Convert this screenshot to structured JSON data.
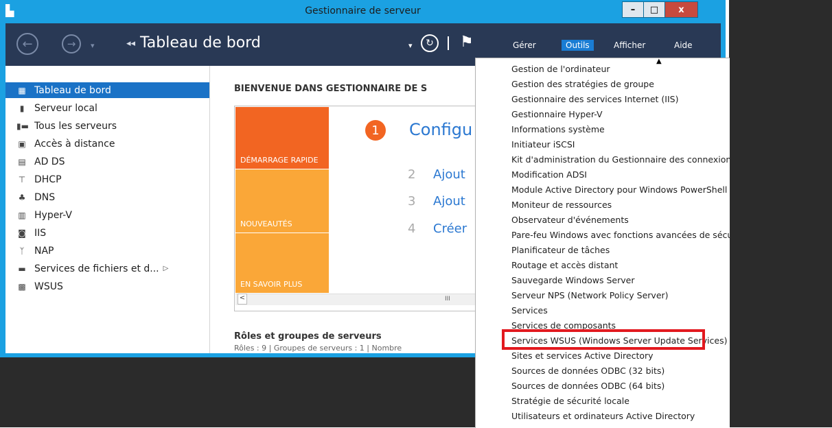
{
  "window": {
    "title": "Gestionnaire de serveur",
    "buttons": {
      "minimize": "–",
      "maximize": "□",
      "close": "x"
    }
  },
  "toolbar": {
    "back": "←",
    "forward": "→",
    "nav_dropdown": "▾",
    "crumb_arrows": "◂◂",
    "page_title": "Tableau de bord",
    "dropdown_arrow": "▾",
    "refresh": "↻",
    "flag": "⚑",
    "menus": [
      "Gérer",
      "Outils",
      "Afficher",
      "Aide"
    ]
  },
  "sidebar": {
    "items": [
      {
        "label": "Tableau de bord",
        "icon": "▦"
      },
      {
        "label": "Serveur local",
        "icon": "▮"
      },
      {
        "label": "Tous les serveurs",
        "icon": "▮▬"
      },
      {
        "label": "Accès à distance",
        "icon": "▣"
      },
      {
        "label": "AD DS",
        "icon": "▤"
      },
      {
        "label": "DHCP",
        "icon": "⊤"
      },
      {
        "label": "DNS",
        "icon": "♣"
      },
      {
        "label": "Hyper-V",
        "icon": "▥"
      },
      {
        "label": "IIS",
        "icon": "◙"
      },
      {
        "label": "NAP",
        "icon": "ᛉ"
      },
      {
        "label": "Services de fichiers et d...",
        "icon": "▬",
        "arrow": "▷"
      },
      {
        "label": "WSUS",
        "icon": "▩"
      }
    ]
  },
  "main": {
    "welcome": "BIENVENUE DANS GESTIONNAIRE DE S",
    "tiles": [
      "DÉMARRAGE RAPIDE",
      "NOUVEAUTÉS",
      "EN SAVOIR PLUS"
    ],
    "steps": [
      {
        "num": "1",
        "text": "Configu"
      },
      {
        "num": "2",
        "text": "Ajout"
      },
      {
        "num": "3",
        "text": "Ajout"
      },
      {
        "num": "4",
        "text": "Créer"
      }
    ],
    "scroll": {
      "left": "<",
      "thumb": "III"
    },
    "roles_title": "Rôles et groupes de serveurs",
    "roles_sub": "Rôles : 9   |   Groupes de serveurs : 1   |   Nombre"
  },
  "dropdown": {
    "caret": "▲",
    "items": [
      "Gestion de l'ordinateur",
      "Gestion des stratégies de groupe",
      "Gestionnaire des services Internet (IIS)",
      "Gestionnaire Hyper-V",
      "Informations système",
      "Initiateur iSCSI",
      "Kit d'administration du Gestionnaire des connexions",
      "Modification ADSI",
      "Module Active Directory pour Windows PowerShell",
      "Moniteur de ressources",
      "Observateur d'événements",
      "Pare-feu Windows avec fonctions avancées de sécurité",
      "Planificateur de tâches",
      "Routage et accès distant",
      "Sauvegarde Windows Server",
      "Serveur NPS (Network Policy Server)",
      "Services",
      "Services de composants",
      "Services WSUS (Windows Server Update Services)",
      "Sites et services Active Directory",
      "Sources de données ODBC (32 bits)",
      "Sources de données ODBC (64 bits)",
      "Stratégie de sécurité locale",
      "Utilisateurs et ordinateurs Active Directory"
    ]
  },
  "colors": {
    "frame": "#1ba1e2",
    "toolbar": "#293955",
    "accent": "#1a72c6",
    "orange": "#f26522",
    "tile_light": "#faa738",
    "highlight": "#e2191f"
  }
}
